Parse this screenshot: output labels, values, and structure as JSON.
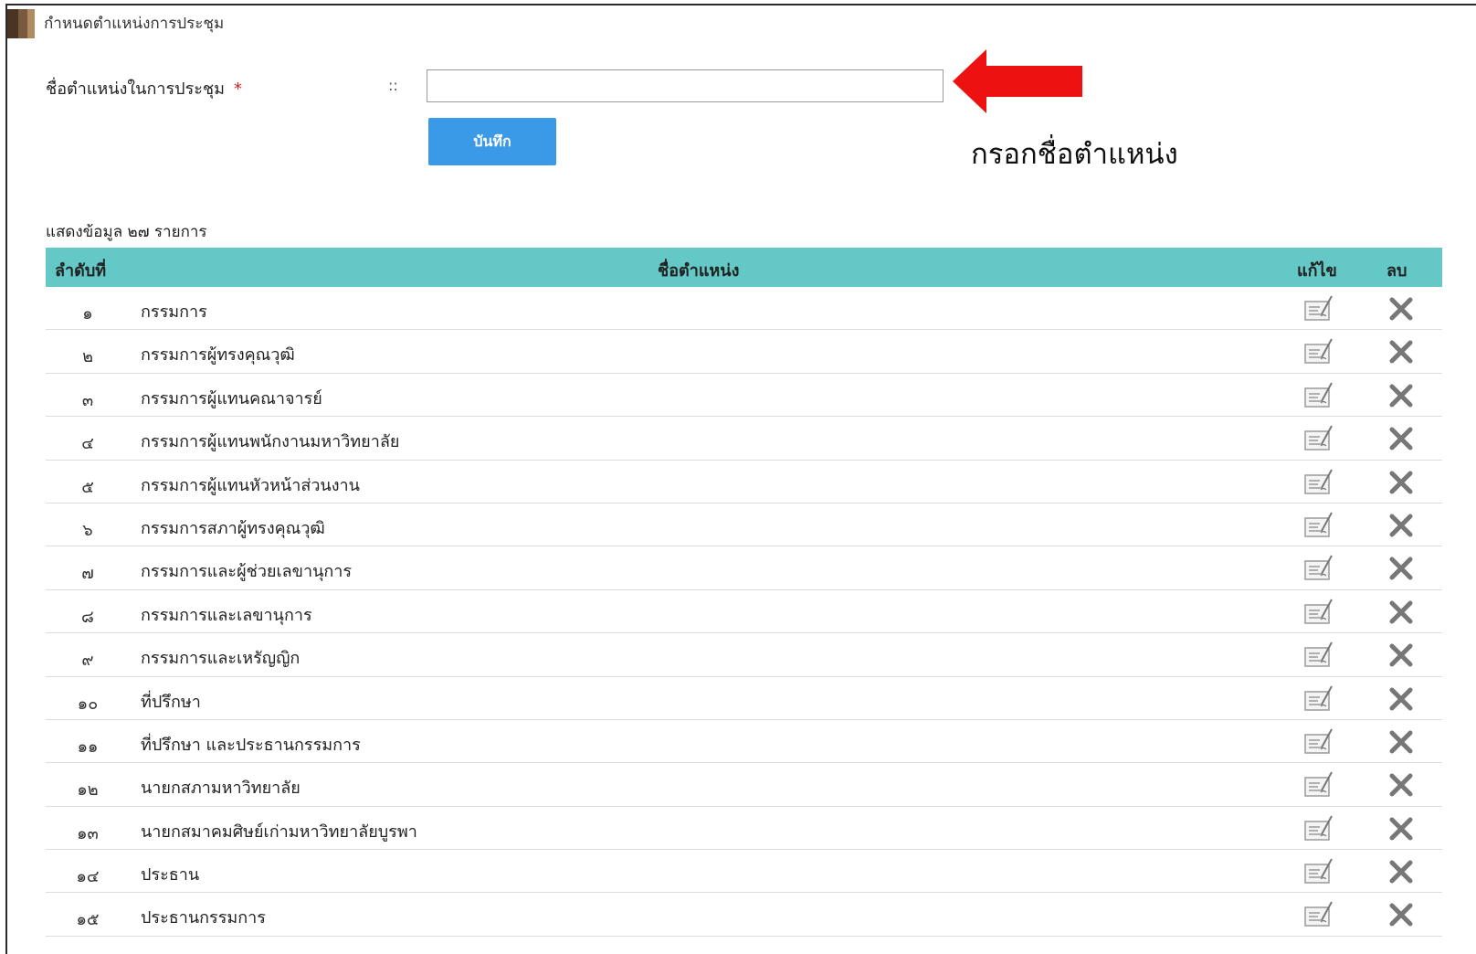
{
  "page_title": "กำหนดตำแหน่งการประชุม",
  "form": {
    "label": "ชื่อตำแหน่งในการประชุม",
    "required_mark": "*",
    "separator": "::",
    "input_value": "",
    "save_label": "บันทึก"
  },
  "annotation": {
    "text": "กรอกชื่อตำแหน่ง",
    "arrow_color": "#ee1111"
  },
  "summary": "แสดงข้อมูล ๒๗ รายการ",
  "table": {
    "header_color": "#64c9c6",
    "columns": {
      "order": "ลำดับที่",
      "name": "ชื่อตำแหน่ง",
      "edit": "แก้ไข",
      "delete": "ลบ"
    },
    "rows": [
      {
        "num": "๑",
        "name": "กรรมการ"
      },
      {
        "num": "๒",
        "name": "กรรมการผู้ทรงคุณวุฒิ"
      },
      {
        "num": "๓",
        "name": "กรรมการผู้แทนคณาจารย์"
      },
      {
        "num": "๔",
        "name": "กรรมการผู้แทนพนักงานมหาวิทยาลัย"
      },
      {
        "num": "๕",
        "name": "กรรมการผู้แทนหัวหน้าส่วนงาน"
      },
      {
        "num": "๖",
        "name": "กรรมการสภาผู้ทรงคุณวุฒิ"
      },
      {
        "num": "๗",
        "name": "กรรมการและผู้ช่วยเลขานุการ"
      },
      {
        "num": "๘",
        "name": "กรรมการและเลขานุการ"
      },
      {
        "num": "๙",
        "name": "กรรมการและเหรัญญิก"
      },
      {
        "num": "๑๐",
        "name": "ที่ปรึกษา"
      },
      {
        "num": "๑๑",
        "name": "ที่ปรึกษา และประธานกรรมการ"
      },
      {
        "num": "๑๒",
        "name": "นายกสภามหาวิทยาลัย"
      },
      {
        "num": "๑๓",
        "name": "นายกสมาคมศิษย์เก่ามหาวิทยาลัยบูรพา"
      },
      {
        "num": "๑๔",
        "name": "ประธาน"
      },
      {
        "num": "๑๕",
        "name": "ประธานกรรมการ"
      }
    ]
  },
  "icons": {
    "edit": "edit-document-icon",
    "delete": "close-x-icon"
  }
}
